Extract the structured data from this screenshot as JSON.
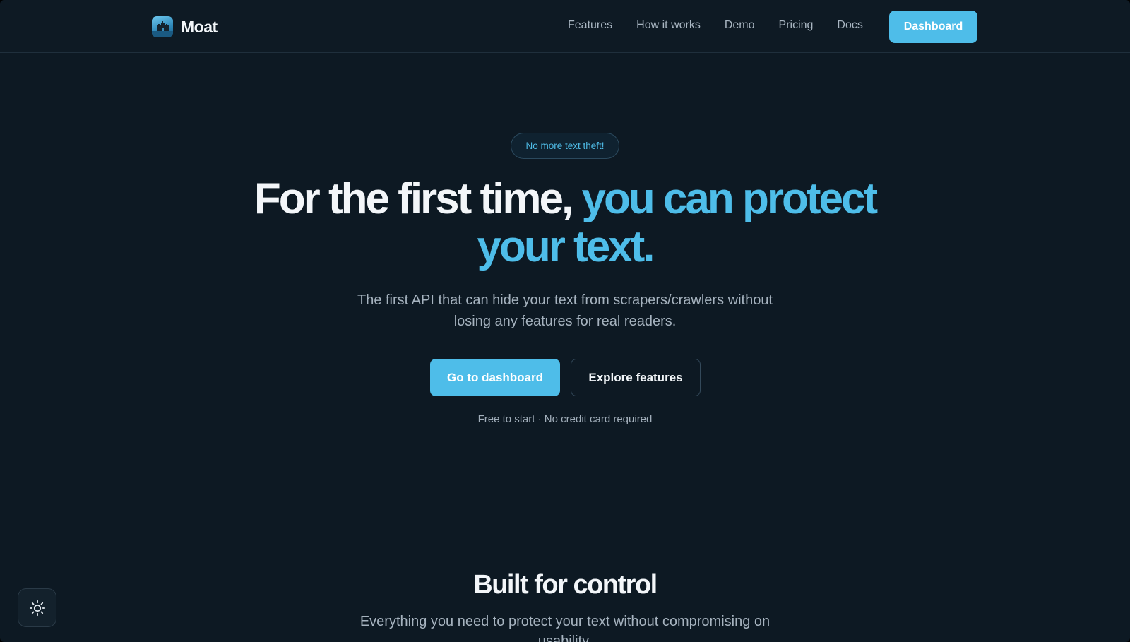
{
  "brand": {
    "name": "Moat",
    "logo_icon": "castle-logo-icon"
  },
  "nav": {
    "links": [
      "Features",
      "How it works",
      "Demo",
      "Pricing",
      "Docs"
    ],
    "dashboard_label": "Dashboard"
  },
  "hero": {
    "badge": "No more text theft!",
    "headline_plain": "For the first time,",
    "headline_accent": "you can protect your text.",
    "subtitle": "The first API that can hide your text from scrapers/crawlers without losing any features for real readers.",
    "primary_cta": "Go to dashboard",
    "secondary_cta": "Explore features",
    "fineprint": "Free to start · No credit card required"
  },
  "section": {
    "title": "Built for control",
    "subtitle": "Everything you need to protect your text without compromising on usability."
  },
  "theme_toggle": {
    "icon": "sun-icon"
  },
  "colors": {
    "background": "#0d1923",
    "accent": "#4ebde9",
    "text": "#f3f6f9",
    "muted": "#a6b3bf"
  }
}
